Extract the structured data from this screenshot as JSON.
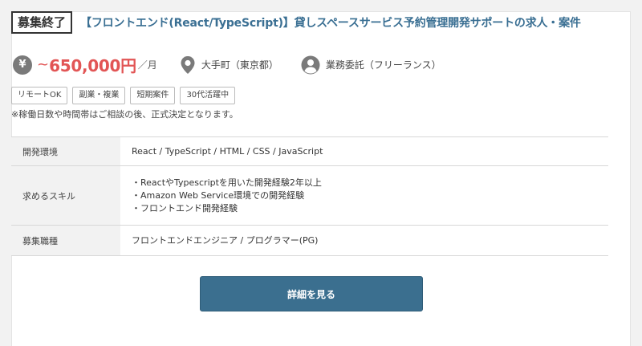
{
  "header": {
    "status_badge": "募集終了",
    "title": "【フロントエンド(React/TypeScript)】貸しスペースサービス予約管理開発サポートの求人・案件"
  },
  "meta": {
    "salary_icon": "yen-icon",
    "salary_icon_glyph": "¥",
    "salary_prefix": "~",
    "salary_value": "650,000円",
    "salary_unit": "／月",
    "location_icon": "map-pin-icon",
    "location": "大手町（東京都）",
    "contract_icon": "person-icon",
    "contract_type": "業務委託（フリーランス）"
  },
  "tags": [
    "リモートOK",
    "副業・複業",
    "短期案件",
    "30代活躍中"
  ],
  "note": "※稼働日数や時間帯はご相談の後、正式決定となります。",
  "details": [
    {
      "label": "開発環境",
      "lines": [
        "React / TypeScript / HTML / CSS / JavaScript"
      ]
    },
    {
      "label": "求めるスキル",
      "lines": [
        "・ReactやTypescriptを用いた開発経験2年以上",
        "・Amazon Web Service環境での開発経験",
        "・フロントエンド開発経験"
      ]
    },
    {
      "label": "募集職種",
      "lines": [
        "フロントエンドエンジニア / プログラマー(PG)"
      ]
    }
  ],
  "actions": {
    "detail_button": "詳細を見る"
  },
  "colors": {
    "accent": "#3b6f8f",
    "title": "#3a6f93",
    "salary": "#e25555"
  }
}
